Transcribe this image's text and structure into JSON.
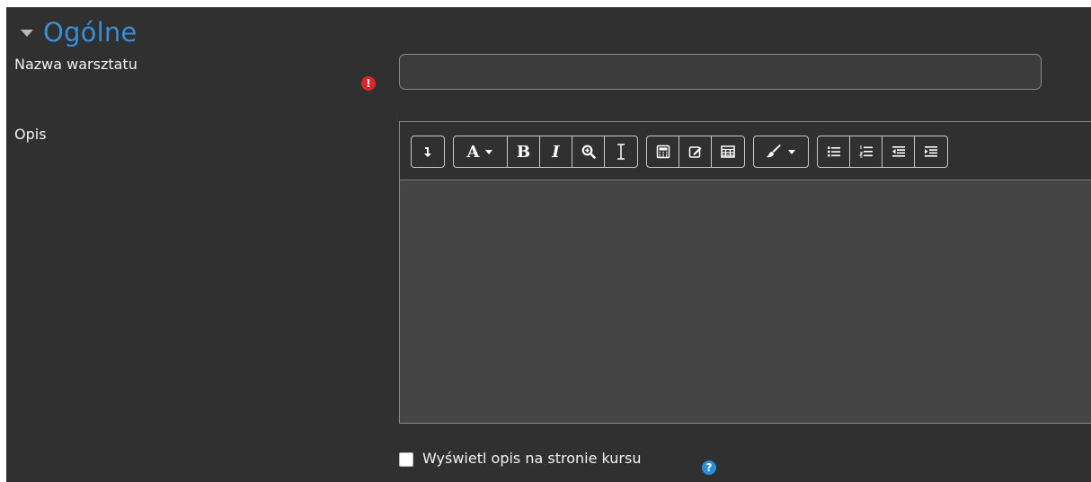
{
  "section": {
    "title": "Ogólne",
    "expanded": true
  },
  "fields": {
    "name": {
      "label": "Nazwa warsztatu",
      "value": "",
      "required_icon": "exclamation-circle-icon",
      "required_color": "#e0262d"
    },
    "description": {
      "label": "Opis",
      "content": ""
    }
  },
  "toolbar": {
    "groups": [
      [
        "collapse-toggle"
      ],
      [
        "font-style",
        "bold",
        "italic",
        "find-replace",
        "clear-formatting"
      ],
      [
        "equation-editor",
        "edit-icon",
        "table"
      ],
      [
        "text-color"
      ],
      [
        "unordered-list",
        "ordered-list",
        "outdent",
        "indent"
      ]
    ],
    "labels": {
      "font": "A",
      "bold": "B",
      "italic": "I"
    }
  },
  "show_description": {
    "label": "Wyświetl opis na stronie kursu",
    "checked": false,
    "help_icon": "question-circle-icon",
    "help_color": "#2b8fd6"
  },
  "colors": {
    "background": "#303030",
    "accent": "#3a8dd6",
    "text": "#f2f2f2",
    "editor_bg": "#444444"
  }
}
